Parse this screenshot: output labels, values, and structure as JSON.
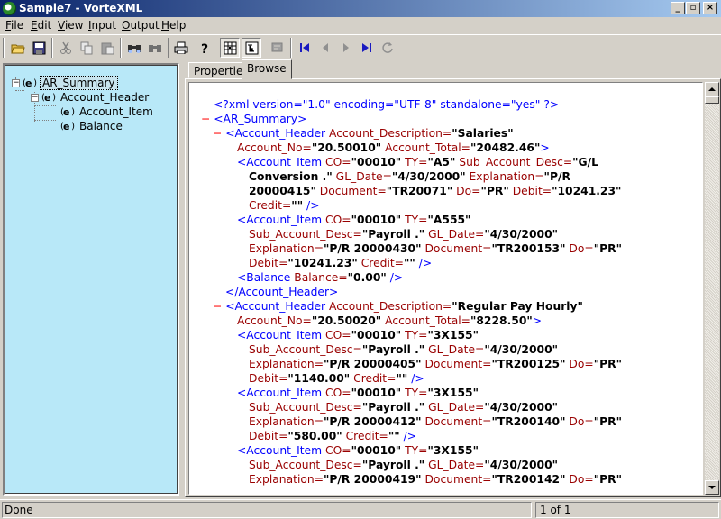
{
  "window": {
    "title": "Sample7 - VorteXML",
    "min": "_",
    "max": "▫",
    "close": "×"
  },
  "menu": [
    {
      "key": "F",
      "rest": "ile"
    },
    {
      "key": "E",
      "rest": "dit"
    },
    {
      "key": "V",
      "rest": "iew"
    },
    {
      "key": "I",
      "rest": "nput"
    },
    {
      "key": "O",
      "rest": "utput"
    },
    {
      "key": "H",
      "rest": "elp"
    }
  ],
  "toolbar": {
    "icons": [
      "open-folder-icon",
      "save-icon",
      "cut-icon",
      "copy-icon",
      "paste-icon",
      "find-icon",
      "find-next-icon",
      "print-icon",
      "help-icon",
      "grid-view-icon",
      "tree-view-icon",
      "comment-icon",
      "first-record-icon",
      "previous-record-icon",
      "next-record-icon",
      "last-record-icon",
      "refresh-icon"
    ]
  },
  "tree": {
    "nodes": [
      {
        "label": "AR_Summary",
        "expander": "−"
      },
      {
        "label": "Account_Header",
        "expander": "−"
      },
      {
        "label": "Account_Item"
      },
      {
        "label": "Balance"
      }
    ],
    "node_glyph": "e"
  },
  "tabs": [
    {
      "label": "Properties"
    },
    {
      "label": "Browse"
    }
  ],
  "xml": {
    "minus": "−",
    "line1": "<?xml version=\"1.0\" encoding=\"UTF-8\" standalone=\"yes\" ?>",
    "l2_tag": "<AR_Summary>",
    "l3_tag": "<Account_Header",
    "l3_a1": "Account_Description=",
    "l3_v1": "\"Salaries\"",
    "l4_a1": "Account_No=",
    "l4_v1": "\"20.50010\"",
    "l4_a2": "Account_Total=",
    "l4_v2": "\"20482.46\"",
    "gt": ">",
    "l5_tag": "<Account_Item",
    "a_co": "CO=",
    "v_co": "\"00010\"",
    "a_ty": "TY=",
    "l5_vty": "\"A5\"",
    "a_sub": "Sub_Account_Desc=",
    "l5_vsub": "\"G/L",
    "l6_vsub": "Conversion .\"",
    "a_gl": "GL_Date=",
    "v_gl": "\"4/30/2000\"",
    "a_exp": "Explanation=",
    "l6_vexp": "\"P/R",
    "l7_vexp": "20000415\"",
    "a_doc": "Document=",
    "l7_vdoc": "\"TR20071\"",
    "a_do": "Do=",
    "v_do": "\"PR\"",
    "a_deb": "Debit=",
    "l7_vdeb": "\"10241.23\"",
    "a_cred": "Credit=",
    "v_cred": "\"\"",
    "close_empty": "/>",
    "l9_vty": "\"A555\"",
    "v_payroll": "\"Payroll .\"",
    "l11_vexp": "\"P/R 20000430\"",
    "l11_vdoc": "\"TR200153\"",
    "l12_vdeb": "\"10241.23\"",
    "l13_tag": "<Balance",
    "a_bal": "Balance=",
    "v_bal": "\"0.00\"",
    "l14_tag": "</Account_Header>",
    "l15_v1": "\"Regular Pay Hourly\"",
    "l16_v1": "\"20.50020\"",
    "l16_v2": "\"8228.50\"",
    "v_3x155": "\"3X155\"",
    "l19_vexp": "\"P/R 20000405\"",
    "l19_vdoc": "\"TR200125\"",
    "l20_vdeb": "\"1140.00\"",
    "l23_vexp": "\"P/R 20000412\"",
    "l23_vdoc": "\"TR200140\"",
    "l24_vdeb": "\"580.00\"",
    "l27_vexp": "\"P/R 20000419\"",
    "l27_vdoc": "\"TR200142\""
  },
  "status": {
    "left": "Done",
    "right": "1 of 1"
  }
}
